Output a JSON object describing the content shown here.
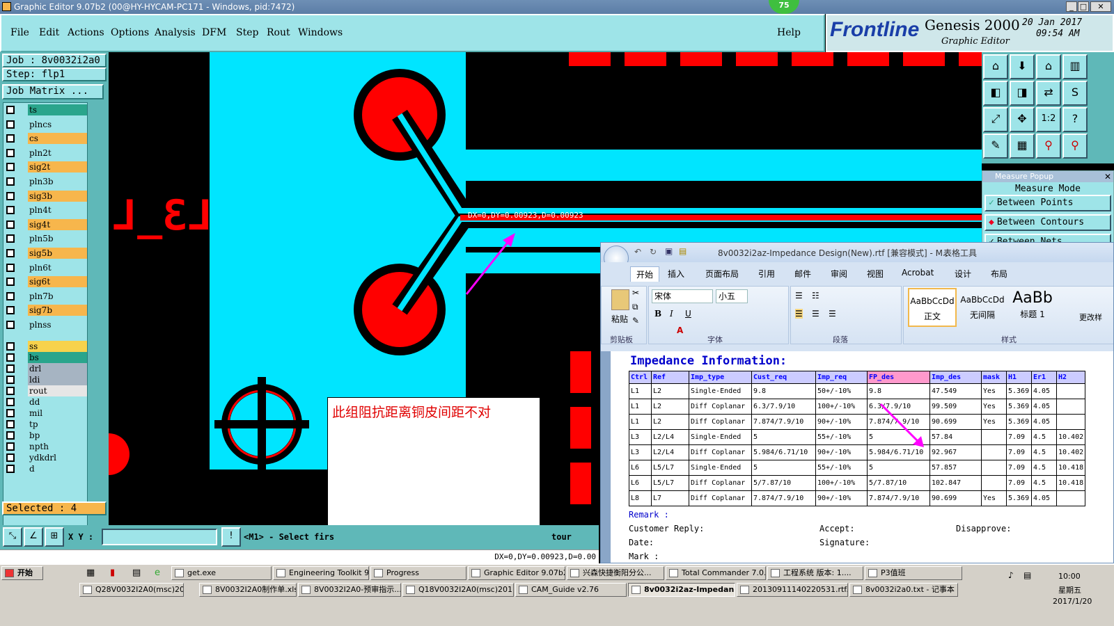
{
  "window": {
    "title": "Graphic Editor 9.07b2 (00@HY-HYCAM-PC171 - Windows, pid:7472)",
    "badge": "75"
  },
  "menu": {
    "items": [
      "File",
      "Edit",
      "Actions",
      "Options",
      "Analysis",
      "DFM",
      "Step",
      "Rout",
      "Windows"
    ],
    "help": "Help"
  },
  "brand": {
    "logo": "Frontline",
    "product": "Genesis 2000",
    "subtitle": "Graphic Editor",
    "date": "20 Jan 2017",
    "time": "09:54 AM"
  },
  "job": {
    "job_label": "Job : 8v0032i2a0",
    "step_label": "Step: flp1",
    "matrix_button": "Job Matrix ..."
  },
  "layers": {
    "group1": [
      {
        "name": "ts",
        "color": "#2aa58c"
      },
      {
        "name": "plncs",
        "color": "#9ee4e8"
      },
      {
        "name": "cs",
        "color": "#f7b64c"
      },
      {
        "name": "pln2t",
        "color": "#9ee4e8"
      },
      {
        "name": "sig2t",
        "color": "#f7b64c"
      },
      {
        "name": "pln3b",
        "color": "#9ee4e8"
      },
      {
        "name": "sig3b",
        "color": "#f7b64c"
      },
      {
        "name": "pln4t",
        "color": "#9ee4e8"
      },
      {
        "name": "sig4t",
        "color": "#f7b64c"
      },
      {
        "name": "pln5b",
        "color": "#9ee4e8"
      },
      {
        "name": "sig5b",
        "color": "#f7b64c"
      },
      {
        "name": "pln6t",
        "color": "#9ee4e8"
      },
      {
        "name": "sig6t",
        "color": "#f7b64c"
      },
      {
        "name": "pln7b",
        "color": "#9ee4e8"
      },
      {
        "name": "sig7b",
        "color": "#f7b64c"
      },
      {
        "name": "plnss",
        "color": "#9ee4e8"
      }
    ],
    "group2": [
      {
        "name": "ss",
        "color": "#f7d24c"
      },
      {
        "name": "bs",
        "color": "#2aa58c"
      }
    ],
    "group3": [
      {
        "name": "drl",
        "color": "#a6b4c2"
      },
      {
        "name": "ldi",
        "color": "#a6b4c2"
      },
      {
        "name": "rout",
        "color": "#e6e6e6"
      }
    ],
    "group4": [
      {
        "name": "dd",
        "color": "#9ee4e8"
      },
      {
        "name": "mil",
        "color": "#9ee4e8"
      },
      {
        "name": "tp",
        "color": "#9ee4e8"
      },
      {
        "name": "bp",
        "color": "#9ee4e8"
      },
      {
        "name": "npth",
        "color": "#9ee4e8"
      },
      {
        "name": "ydkdrl",
        "color": "#9ee4e8"
      },
      {
        "name": "d",
        "color": "#9ee4e8"
      }
    ]
  },
  "selected": "Selected : 4",
  "bottom": {
    "xy_label": "X Y :",
    "prompt": "<M1> - Select firs",
    "prompt_tail": "tour",
    "status": "DX=0,DY=0.00923,D=0.00"
  },
  "canvas": {
    "measure_text": "DX=0,DY=0.00923,D=0.00923",
    "board_label": "L3_L",
    "note": "此组阻抗距离铜皮间距不对"
  },
  "measure_popup": {
    "title": "Measure Popup",
    "mode": "Measure Mode",
    "options": [
      "Between Points",
      "Between Contours",
      "Between Nets"
    ]
  },
  "word": {
    "title": "8v0032i2az-Impedance Design(New).rtf [兼容模式] - M...",
    "table_tools": "表格工具",
    "tabs": [
      "开始",
      "插入",
      "页面布局",
      "引用",
      "邮件",
      "审阅",
      "视图",
      "Acrobat",
      "设计",
      "布局"
    ],
    "font_name": "宋体",
    "font_size": "小五",
    "paste": "粘贴",
    "groups": [
      "剪贴板",
      "字体",
      "段落",
      "样式"
    ],
    "styles": [
      {
        "sample": "AaBbCcDd",
        "name": "正文"
      },
      {
        "sample": "AaBbCcDd",
        "name": "无间隔"
      },
      {
        "sample": "AaBb",
        "name": "标题 1"
      }
    ],
    "change_style": "更改样",
    "doc_title": "Impedance Information:",
    "headers": [
      "Ctrl",
      "Ref",
      "Imp_type",
      "Cust_req",
      "Imp_req",
      "FP_des",
      "Imp_des",
      "mask",
      "H1",
      "Er1",
      "H2"
    ],
    "rows": [
      [
        "L1",
        "L2",
        "Single-Ended",
        "9.8",
        "50+/-10%",
        "9.8",
        "47.549",
        "Yes",
        "5.369",
        "4.05",
        ""
      ],
      [
        "L1",
        "L2",
        "Diff Coplanar",
        "6.3/7.9/10",
        "100+/-10%",
        "6.3/7.9/10",
        "99.509",
        "Yes",
        "5.369",
        "4.05",
        ""
      ],
      [
        "L1",
        "L2",
        "Diff Coplanar",
        "7.874/7.9/10",
        "90+/-10%",
        "7.874/7.9/10",
        "90.699",
        "Yes",
        "5.369",
        "4.05",
        ""
      ],
      [
        "L3",
        "L2/L4",
        "Single-Ended",
        "5",
        "55+/-10%",
        "5",
        "57.84",
        "",
        "7.09",
        "4.5",
        "10.402"
      ],
      [
        "L3",
        "L2/L4",
        "Diff Coplanar",
        "5.984/6.71/10",
        "90+/-10%",
        "5.984/6.71/10",
        "92.967",
        "",
        "7.09",
        "4.5",
        "10.402"
      ],
      [
        "L6",
        "L5/L7",
        "Single-Ended",
        "5",
        "55+/-10%",
        "5",
        "57.857",
        "",
        "7.09",
        "4.5",
        "10.418"
      ],
      [
        "L6",
        "L5/L7",
        "Diff Coplanar",
        "5/7.87/10",
        "100+/-10%",
        "5/7.87/10",
        "102.847",
        "",
        "7.09",
        "4.5",
        "10.418"
      ],
      [
        "L8",
        "L7",
        "Diff Coplanar",
        "7.874/7.9/10",
        "90+/-10%",
        "7.874/7.9/10",
        "90.699",
        "Yes",
        "5.369",
        "4.05",
        ""
      ]
    ],
    "remark": "Remark :",
    "customer_reply": "Customer Reply:",
    "accept": "Accept:",
    "disapprove": "Disapprove:",
    "date": "Date:",
    "signature": "Signature:",
    "mark": "Mark :"
  },
  "taskbar": {
    "start": "开始",
    "row1": [
      "get.exe",
      "Engineering Toolkit 9....",
      "Progress",
      "Graphic Editor 9.07b2...",
      "兴森快捷衡阳分公...",
      "Total Commander 7.0...",
      "工程系统  版本: 1....",
      "P3值班"
    ],
    "row2": [
      "Q28V0032I2A0(msc)201...",
      "8V0032I2A0制作单.xls",
      "8V0032I2A0-预审指示....",
      "Q18V0032I2A0(msc)201...",
      "CAM_Guide v2.76",
      "8v0032i2az-Impedan...",
      "20130911140220531.rtf...",
      "8v0032i2a0.txt - 记事本"
    ],
    "time": "10:00",
    "weekday": "星期五",
    "date": "2017/1/20"
  }
}
